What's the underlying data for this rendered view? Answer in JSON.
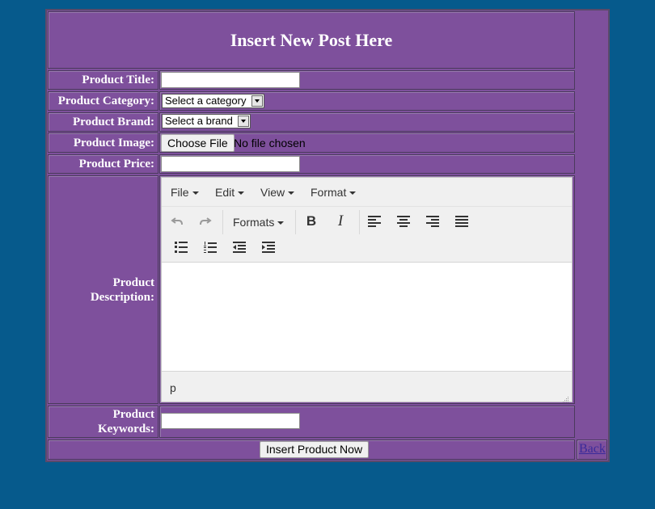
{
  "form": {
    "heading": "Insert New Post Here",
    "labels": {
      "title": "Product Title:",
      "category": "Product Category:",
      "brand": "Product Brand:",
      "image": "Product Image:",
      "price": "Product Price:",
      "description_1": "Product",
      "description_2": "Description:",
      "keywords_1": "Product",
      "keywords_2": "Keywords:"
    },
    "inputs": {
      "title_value": "",
      "price_value": "",
      "keywords_value": ""
    },
    "category_select": "Select a category",
    "brand_select": "Select a brand",
    "file_button": "Choose File",
    "file_status": "No file chosen",
    "submit_label": "Insert Product Now",
    "back_link": "Back"
  },
  "editor": {
    "menus": [
      "File",
      "Edit",
      "View",
      "Format"
    ],
    "formats_label": "Formats",
    "toolbar_icons": [
      "undo-icon",
      "redo-icon",
      "bold-icon",
      "italic-icon",
      "align-left-icon",
      "align-center-icon",
      "align-right-icon",
      "align-justify-icon",
      "bullet-list-icon",
      "numbered-list-icon",
      "outdent-icon",
      "indent-icon"
    ],
    "status_path": "p"
  },
  "colors": {
    "page_background": "#065a8c",
    "form_background": "#7e509c"
  }
}
